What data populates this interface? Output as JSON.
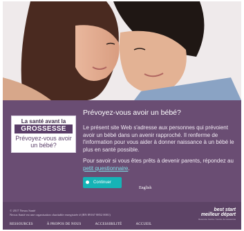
{
  "logo": {
    "line1": "La santé avant la",
    "line2": "GROSSESSE",
    "line3": "Prévoyez-vous avoir un bébé?"
  },
  "main": {
    "heading": "Prévoyez-vous avoir un bébé?",
    "paragraph1": "Le présent site Web s'adresse aux personnes qui prévoient avoir un bébé dans un avenir rapproché. Il renferme de l'information pour vous aider à donner naissance à un bébé le plus en santé possible.",
    "paragraph2_text": "Pour savoir si vous êtes prêts à devenir parents, répondez au",
    "paragraph2_link": "petit questionnaire",
    "paragraph2_end": ".",
    "cta_label": "Continuer",
    "language_link": "English"
  },
  "footer": {
    "copyright_line1": "© 2017 Nexus Santé",
    "copyright_line2": "Nexus Santé est une organisation charitable enregistrée # (BN 89167 8852 0001)",
    "nav": [
      "RESSOURCES",
      "À PROPOS DE NOUS",
      "ACCESSIBILITÉ",
      "ACCUEIL"
    ],
    "brand_line1": "best start",
    "brand_line2": "meilleur départ",
    "brand_line3": "Resource Centre / Centre de ressources"
  },
  "colors": {
    "purple": "#6a4d73",
    "footer_purple": "#5d4366",
    "teal": "#16b3b6",
    "link": "#7fe0e8"
  }
}
